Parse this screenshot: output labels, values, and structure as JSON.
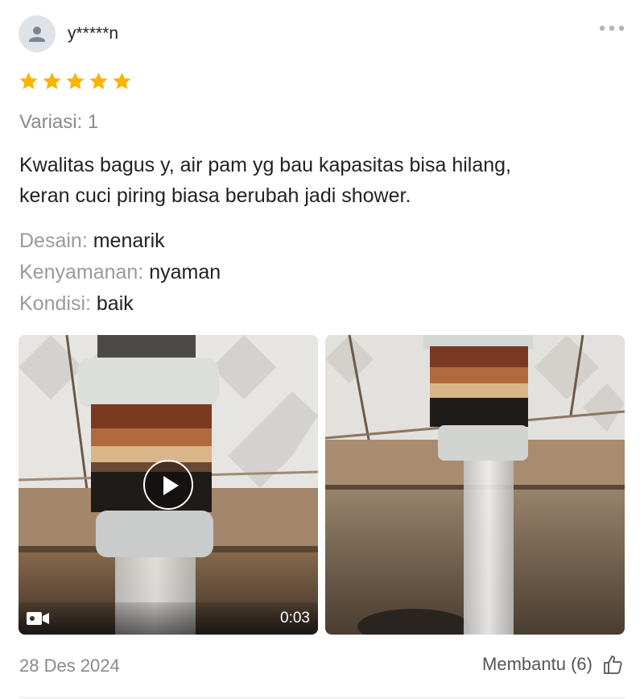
{
  "reviewer": {
    "username": "y*****n",
    "avatar_icon": "person-icon"
  },
  "rating": {
    "stars": 5,
    "max": 5,
    "color": "#F7B500"
  },
  "variation": "Variasi: 1",
  "review": {
    "line1": "Kwalitas bagus y, air pam yg bau kapasitas bisa hilang,",
    "line2": "keran cuci piring biasa berubah jadi shower."
  },
  "attributes": [
    {
      "label": "Desain:",
      "value": "menarik"
    },
    {
      "label": "Kenyamanan:",
      "value": "nyaman"
    },
    {
      "label": "Kondisi:",
      "value": "baik"
    }
  ],
  "media": [
    {
      "type": "video",
      "duration": "0:03",
      "icon": "video-camera-icon",
      "play_icon": "play-icon"
    },
    {
      "type": "photo"
    }
  ],
  "footer": {
    "date": "28 Des 2024",
    "helpful_label": "Membantu (6)",
    "helpful_icon": "thumbs-up-icon"
  },
  "more_icon": "more-dots-icon"
}
